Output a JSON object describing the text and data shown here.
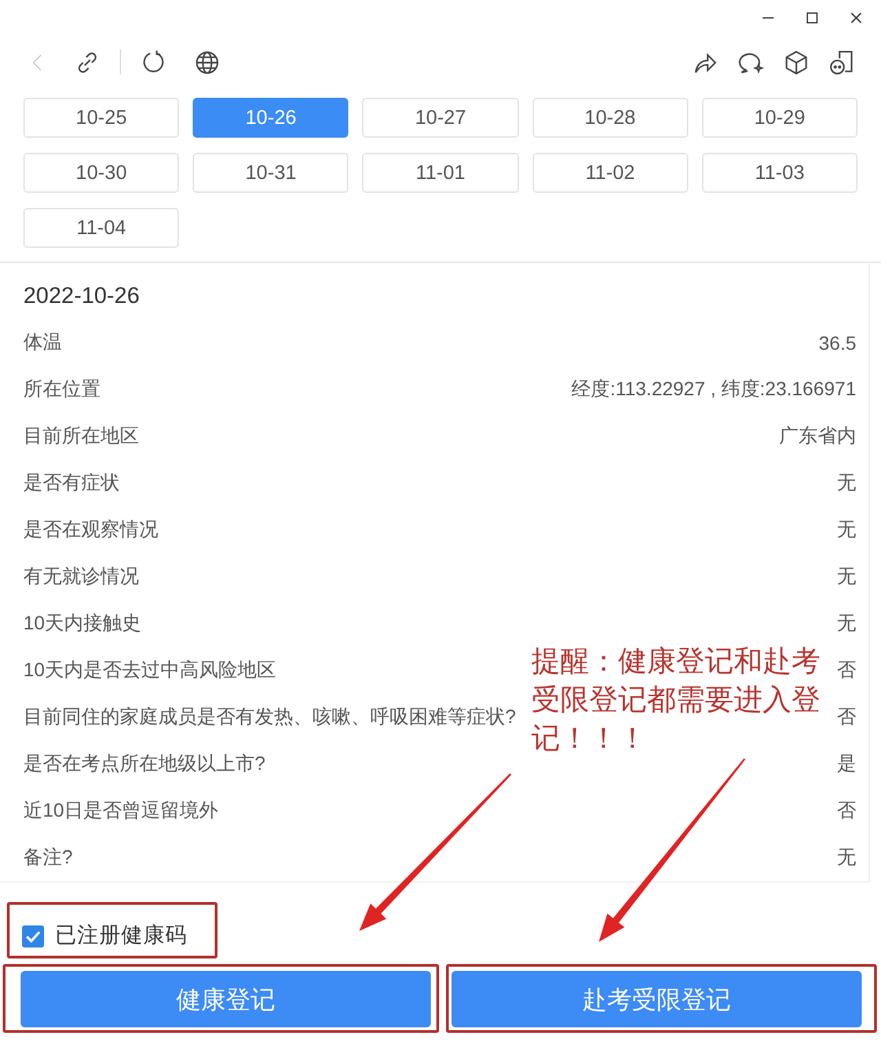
{
  "back": {
    "disabled": true
  },
  "dates": [
    {
      "label": "10-25",
      "selected": false
    },
    {
      "label": "10-26",
      "selected": true
    },
    {
      "label": "10-27",
      "selected": false
    },
    {
      "label": "10-28",
      "selected": false
    },
    {
      "label": "10-29",
      "selected": false
    },
    {
      "label": "10-30",
      "selected": false
    },
    {
      "label": "10-31",
      "selected": false
    },
    {
      "label": "11-01",
      "selected": false
    },
    {
      "label": "11-02",
      "selected": false
    },
    {
      "label": "11-03",
      "selected": false
    },
    {
      "label": "11-04",
      "selected": false
    }
  ],
  "record": {
    "date": "2022-10-26",
    "fields": [
      {
        "label": "体温",
        "value": "36.5"
      },
      {
        "label": "所在位置",
        "value": "经度:113.22927 , 纬度:23.166971"
      },
      {
        "label": "目前所在地区",
        "value": "广东省内"
      },
      {
        "label": "是否有症状",
        "value": "无"
      },
      {
        "label": "是否在观察情况",
        "value": "无"
      },
      {
        "label": "有无就诊情况",
        "value": "无"
      },
      {
        "label": "10天内接触史",
        "value": "无"
      },
      {
        "label": "10天内是否去过中高风险地区",
        "value": "否"
      },
      {
        "label": "目前同住的家庭成员是否有发热、咳嗽、呼吸困难等症状?",
        "value": "否"
      },
      {
        "label": "是否在考点所在地级以上市?",
        "value": "是"
      },
      {
        "label": "近10日是否曾逗留境外",
        "value": "否"
      },
      {
        "label": "备注?",
        "value": "无"
      }
    ]
  },
  "checkbox": {
    "label": "已注册健康码",
    "checked": true
  },
  "buttons": [
    "健康登记",
    "赴考受限登记"
  ],
  "annotation": {
    "text": "提醒：健康登记和赴考受限登记都需要进入登记！！！"
  }
}
